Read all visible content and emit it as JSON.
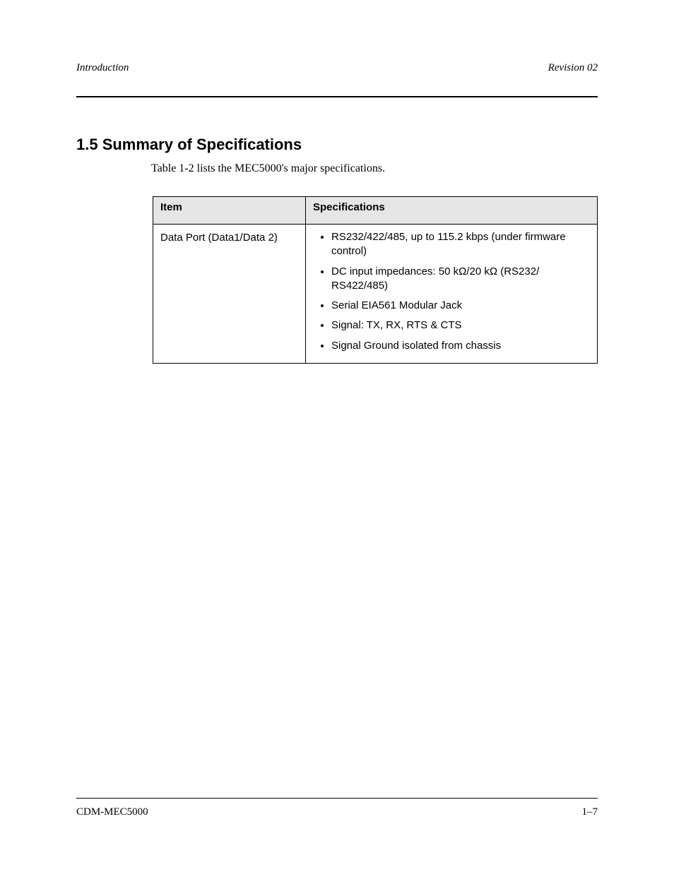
{
  "header": {
    "left": "Introduction",
    "right": "Revision 02"
  },
  "section": {
    "title": "1.5 Summary of Specifications",
    "subtitle": "Table 1-2 lists the MEC5000's major specifications."
  },
  "table": {
    "col1": "Item",
    "col2": "Specifications",
    "rows": [
      {
        "item": "Data Port (Data1/Data 2)",
        "specs": [
          "RS232/422/485, up to 115.2 kbps (under firmware control)",
          "DC input impedances: 50 kΩ/20 kΩ (RS232/ RS422/485)",
          "Serial EIA561 Modular Jack",
          "Signal: TX, RX, RTS & CTS",
          "Signal Ground isolated from chassis"
        ]
      }
    ]
  },
  "footer": {
    "left": "CDM-MEC5000",
    "right": "1–7"
  }
}
